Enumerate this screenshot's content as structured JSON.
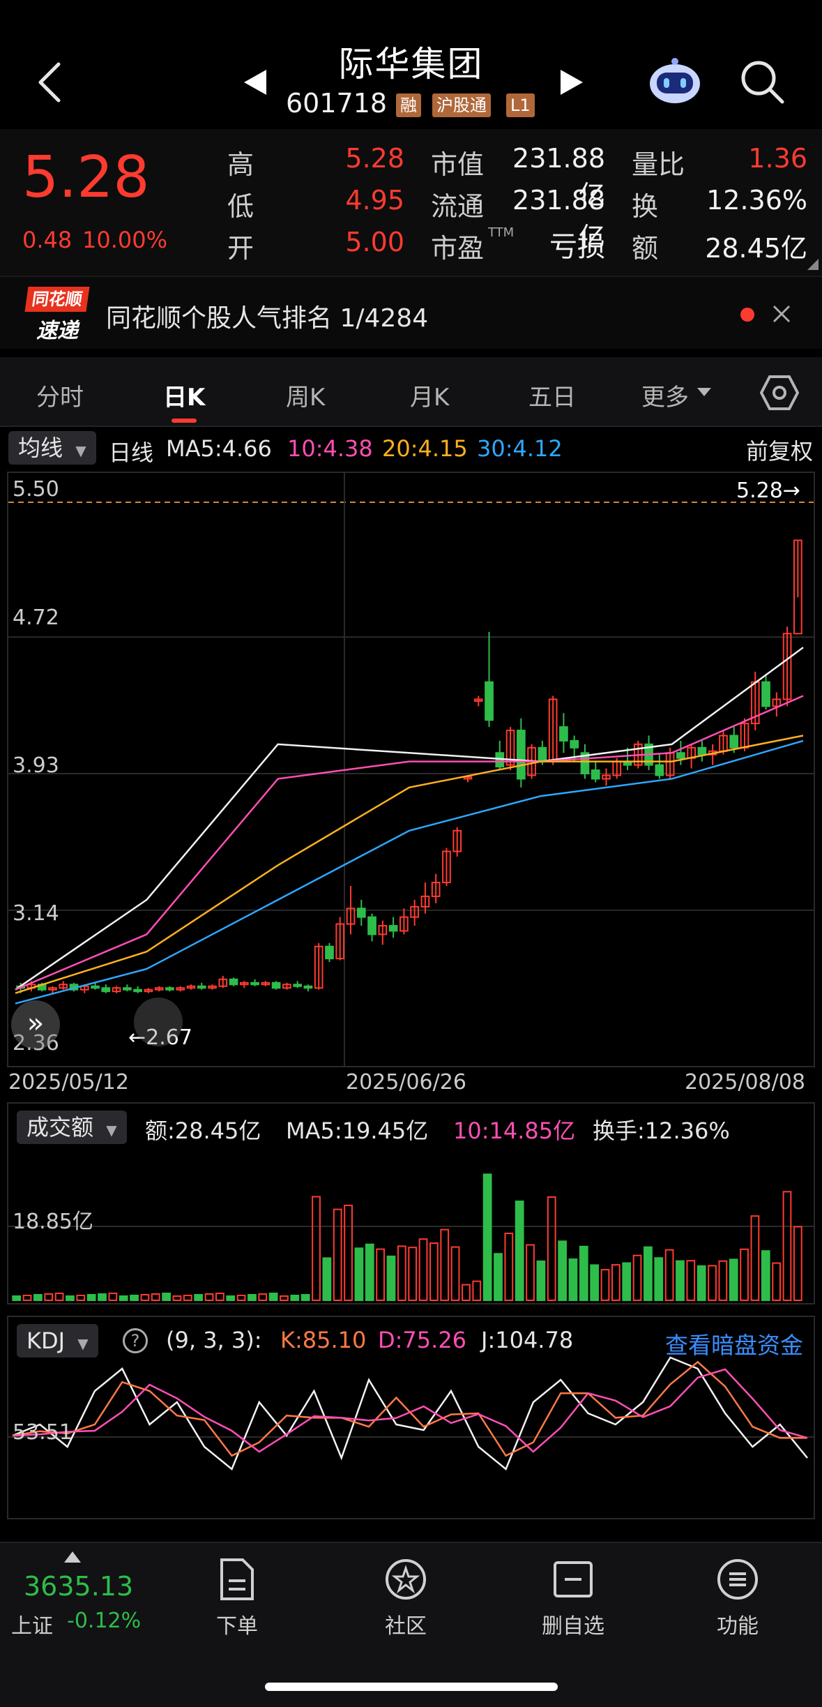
{
  "header": {
    "title": "际华集团",
    "code": "601718",
    "tags": [
      "融",
      "沪股通",
      "L1"
    ]
  },
  "quote": {
    "price": "5.28",
    "change": "0.48",
    "change_pct": "10.00%",
    "high_label": "高",
    "high": "5.28",
    "low_label": "低",
    "low": "4.95",
    "open_label": "开",
    "open": "5.00",
    "mktcap_label": "市值",
    "mktcap": "231.88亿",
    "float_label": "流通",
    "float": "231.88亿",
    "pe_label": "市盈",
    "pe_sup": "TTM",
    "pe": "亏损",
    "volratio_label": "量比",
    "volratio": "1.36",
    "turnover_label": "换",
    "turnover": "12.36%",
    "amount_label": "额",
    "amount": "28.45亿"
  },
  "promo": {
    "logo_top": "同花顺",
    "logo_bottom": "速递",
    "text": "同花顺个股人气排名 1/4284"
  },
  "tabs": [
    {
      "label": "分时"
    },
    {
      "label": "日K"
    },
    {
      "label": "周K"
    },
    {
      "label": "月K"
    },
    {
      "label": "五日"
    },
    {
      "label": "更多"
    }
  ],
  "kline": {
    "selector": "均线",
    "line_type": "日线",
    "ma5": "MA5:4.66",
    "ma10": "10:4.38",
    "ma20": "20:4.15",
    "ma30": "30:4.12",
    "adjust": "前复权",
    "price_marker": "5.28→",
    "min_marker": "←2.67",
    "y_labels": [
      "5.50",
      "4.72",
      "3.93",
      "3.14",
      "2.36"
    ],
    "dates": [
      "2025/05/12",
      "2025/06/26",
      "2025/08/08"
    ]
  },
  "volume": {
    "selector": "成交额",
    "amount": "额:28.45亿",
    "ma5": "MA5:19.45亿",
    "ma10": "10:14.85亿",
    "turnover": "换手:12.36%",
    "y_label": "18.85亿"
  },
  "kdj": {
    "selector": "KDJ",
    "params": "(9, 3, 3):",
    "k": "K:85.10",
    "d": "D:75.26",
    "j": "J:104.78",
    "link": "查看暗盘资金",
    "y_label": "53.51"
  },
  "chart_data": {
    "type": "candlestick",
    "y_range": [
      2.36,
      5.5
    ],
    "x_dates": [
      "2025/05/12",
      "2025/06/26",
      "2025/08/08"
    ],
    "ohlc": [
      [
        2.7,
        2.72,
        2.66,
        2.69
      ],
      [
        2.69,
        2.73,
        2.67,
        2.71
      ],
      [
        2.71,
        2.72,
        2.67,
        2.68
      ],
      [
        2.68,
        2.7,
        2.66,
        2.69
      ],
      [
        2.69,
        2.73,
        2.68,
        2.71
      ],
      [
        2.71,
        2.72,
        2.67,
        2.68
      ],
      [
        2.68,
        2.71,
        2.66,
        2.7
      ],
      [
        2.7,
        2.72,
        2.68,
        2.69
      ],
      [
        2.69,
        2.71,
        2.66,
        2.67
      ],
      [
        2.67,
        2.7,
        2.66,
        2.69
      ],
      [
        2.69,
        2.71,
        2.67,
        2.68
      ],
      [
        2.68,
        2.7,
        2.66,
        2.67
      ],
      [
        2.67,
        2.69,
        2.66,
        2.68
      ],
      [
        2.68,
        2.7,
        2.67,
        2.69
      ],
      [
        2.69,
        2.7,
        2.67,
        2.68
      ],
      [
        2.68,
        2.7,
        2.67,
        2.69
      ],
      [
        2.69,
        2.71,
        2.68,
        2.7
      ],
      [
        2.7,
        2.72,
        2.68,
        2.69
      ],
      [
        2.69,
        2.71,
        2.68,
        2.7
      ],
      [
        2.7,
        2.76,
        2.69,
        2.74
      ],
      [
        2.74,
        2.75,
        2.7,
        2.71
      ],
      [
        2.71,
        2.73,
        2.69,
        2.72
      ],
      [
        2.72,
        2.74,
        2.7,
        2.71
      ],
      [
        2.71,
        2.73,
        2.7,
        2.72
      ],
      [
        2.72,
        2.73,
        2.68,
        2.69
      ],
      [
        2.69,
        2.72,
        2.68,
        2.71
      ],
      [
        2.71,
        2.73,
        2.69,
        2.7
      ],
      [
        2.7,
        2.71,
        2.67,
        2.69
      ],
      [
        2.69,
        2.95,
        2.68,
        2.93
      ],
      [
        2.93,
        2.95,
        2.84,
        2.86
      ],
      [
        2.86,
        3.1,
        2.85,
        3.06
      ],
      [
        3.06,
        3.28,
        3.0,
        3.15
      ],
      [
        3.15,
        3.2,
        3.05,
        3.1
      ],
      [
        3.1,
        3.12,
        2.96,
        3.0
      ],
      [
        3.0,
        3.08,
        2.94,
        3.05
      ],
      [
        3.05,
        3.1,
        2.98,
        3.02
      ],
      [
        3.02,
        3.15,
        3.0,
        3.1
      ],
      [
        3.1,
        3.2,
        3.05,
        3.16
      ],
      [
        3.16,
        3.3,
        3.12,
        3.22
      ],
      [
        3.22,
        3.35,
        3.18,
        3.3
      ],
      [
        3.3,
        3.5,
        3.28,
        3.48
      ],
      [
        3.48,
        3.62,
        3.45,
        3.6
      ],
      [
        3.9,
        3.92,
        3.88,
        3.91
      ],
      [
        4.35,
        4.38,
        4.32,
        4.36
      ],
      [
        4.46,
        4.75,
        4.2,
        4.24
      ],
      [
        4.05,
        4.12,
        3.95,
        3.97
      ],
      [
        3.98,
        4.2,
        3.95,
        4.18
      ],
      [
        4.18,
        4.25,
        3.85,
        3.9
      ],
      [
        3.92,
        4.1,
        3.9,
        4.08
      ],
      [
        4.08,
        4.12,
        3.98,
        4.0
      ],
      [
        4.0,
        4.38,
        3.98,
        4.36
      ],
      [
        4.2,
        4.28,
        4.05,
        4.12
      ],
      [
        4.12,
        4.15,
        4.0,
        4.08
      ],
      [
        4.05,
        4.1,
        3.9,
        3.93
      ],
      [
        3.95,
        4.0,
        3.88,
        3.9
      ],
      [
        3.9,
        3.96,
        3.86,
        3.92
      ],
      [
        3.92,
        4.02,
        3.9,
        4.0
      ],
      [
        4.0,
        4.08,
        3.95,
        3.98
      ],
      [
        3.98,
        4.12,
        3.96,
        4.1
      ],
      [
        4.1,
        4.15,
        3.95,
        3.98
      ],
      [
        3.98,
        4.05,
        3.9,
        3.92
      ],
      [
        3.92,
        4.08,
        3.9,
        4.05
      ],
      [
        4.05,
        4.12,
        3.98,
        4.02
      ],
      [
        4.02,
        4.1,
        3.96,
        4.08
      ],
      [
        4.08,
        4.12,
        4.0,
        4.04
      ],
      [
        4.04,
        4.1,
        3.98,
        4.06
      ],
      [
        4.06,
        4.18,
        4.04,
        4.15
      ],
      [
        4.15,
        4.2,
        4.05,
        4.08
      ],
      [
        4.08,
        4.25,
        4.06,
        4.22
      ],
      [
        4.22,
        4.52,
        4.18,
        4.46
      ],
      [
        4.46,
        4.5,
        4.3,
        4.32
      ],
      [
        4.32,
        4.4,
        4.26,
        4.36
      ],
      [
        4.36,
        4.78,
        4.32,
        4.74
      ],
      [
        4.74,
        5.28,
        4.95,
        5.28
      ]
    ],
    "ma_series": [
      {
        "name": "MA5",
        "values": [
          2.68,
          3.2,
          4.1,
          4.05,
          4.0,
          4.1,
          4.66
        ]
      },
      {
        "name": "10",
        "values": [
          2.68,
          3.0,
          3.9,
          4.0,
          4.0,
          4.05,
          4.38
        ]
      },
      {
        "name": "20",
        "values": [
          2.66,
          2.9,
          3.4,
          3.85,
          4.0,
          4.0,
          4.15
        ]
      },
      {
        "name": "30",
        "values": [
          2.6,
          2.8,
          3.2,
          3.6,
          3.8,
          3.9,
          4.12
        ]
      }
    ]
  }
}
